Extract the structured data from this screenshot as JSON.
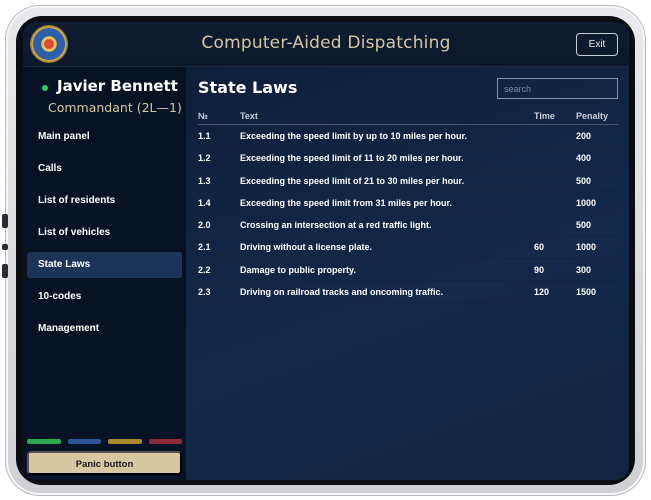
{
  "app": {
    "title": "Computer-Aided Dispatching",
    "exit_label": "Exit"
  },
  "user": {
    "name": "Javier Bennett",
    "role": "Commandant (2L—1)",
    "status_color": "#32c56a"
  },
  "sidebar": {
    "items": [
      {
        "label": "Main panel",
        "active": false
      },
      {
        "label": "Calls",
        "active": false
      },
      {
        "label": "List of residents",
        "active": false
      },
      {
        "label": "List of vehicles",
        "active": false
      },
      {
        "label": "State Laws",
        "active": true
      },
      {
        "label": "10-codes",
        "active": false
      },
      {
        "label": "Management",
        "active": false
      }
    ],
    "status_colors": [
      "#2ea84f",
      "#2b5594",
      "#a8892d",
      "#8a2a3a"
    ],
    "panic_label": "Panic button"
  },
  "main": {
    "title": "State Laws",
    "search_placeholder": "search",
    "columns": [
      "№",
      "Text",
      "Time",
      "Penalty"
    ],
    "rows": [
      {
        "no": "1.1",
        "text": "Exceeding the speed limit by up to 10 miles per hour.",
        "time": "",
        "penalty": "200"
      },
      {
        "no": "1.2",
        "text": "Exceeding the speed limit of 11 to 20 miles per hour.",
        "time": "",
        "penalty": "400"
      },
      {
        "no": "1.3",
        "text": "Exceeding the speed limit of 21 to 30 miles per hour.",
        "time": "",
        "penalty": "500"
      },
      {
        "no": "1.4",
        "text": "Exceeding the speed limit from 31 miles per hour.",
        "time": "",
        "penalty": "1000"
      },
      {
        "no": "2.0",
        "text": "Crossing an intersection at a red traffic light.",
        "time": "",
        "penalty": "500"
      },
      {
        "no": "2.1",
        "text": "Driving without a license plate.",
        "time": "60",
        "penalty": "1000"
      },
      {
        "no": "2.2",
        "text": "Damage to public property.",
        "time": "90",
        "penalty": "300"
      },
      {
        "no": "2.3",
        "text": "Driving on railroad tracks and oncoming traffic.",
        "time": "120",
        "penalty": "1500"
      }
    ]
  }
}
